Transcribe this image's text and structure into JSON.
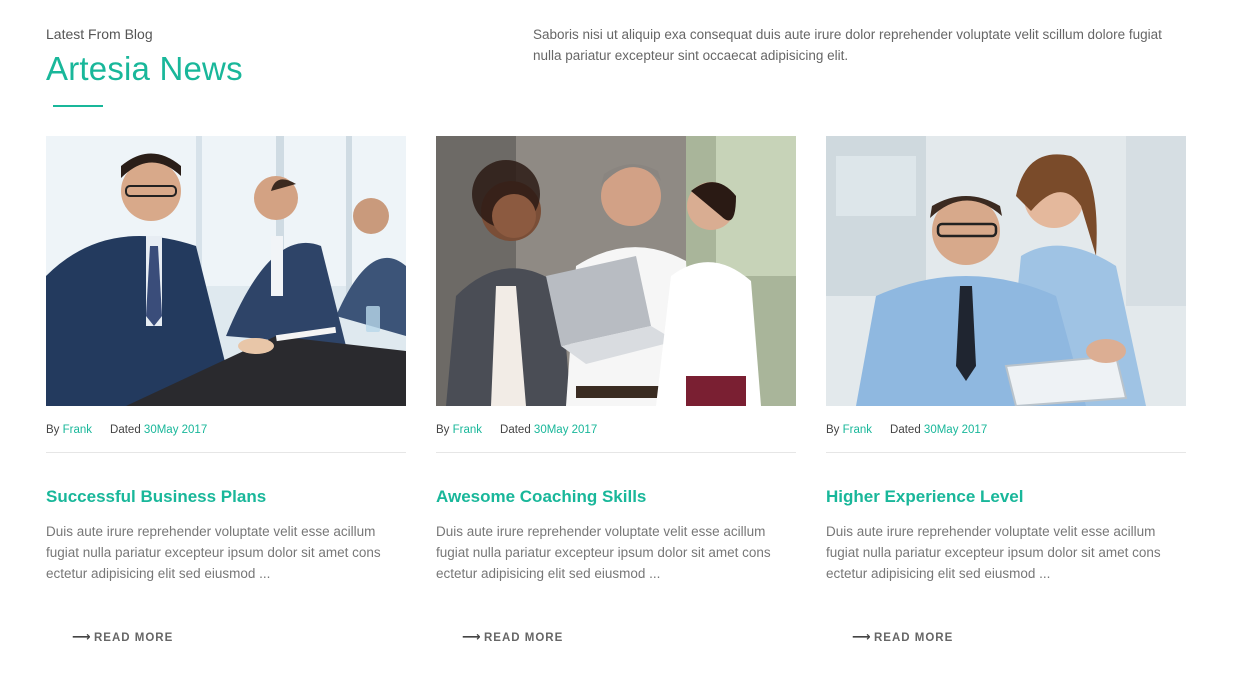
{
  "header": {
    "eyebrow": "Latest From Blog",
    "title": "Artesia News",
    "intro": "Saboris nisi ut aliquip exa consequat duis aute irure dolor reprehender voluptate velit scillum dolore fugiat nulla pariatur excepteur sint occaecat adipisicing elit."
  },
  "colors": {
    "accent": "#19b79a",
    "text": "#666666",
    "rule": "#e6e6e6"
  },
  "posts": [
    {
      "by_label": "By",
      "author": "Frank",
      "dated_label": "Dated",
      "date": "30May 2017",
      "title": "Successful Business Plans",
      "excerpt": "Duis aute irure reprehender voluptate velit esse acillum fugiat nulla pariatur excepteur ipsum dolor sit amet cons ectetur adipisicing elit sed eiusmod ...",
      "read_more": "READ MORE",
      "read_more_icon": "long-arrow-right-icon"
    },
    {
      "by_label": "By",
      "author": "Frank",
      "dated_label": "Dated",
      "date": "30May 2017",
      "title": "Awesome Coaching Skills",
      "excerpt": "Duis aute irure reprehender voluptate velit esse acillum fugiat nulla pariatur excepteur ipsum dolor sit amet cons ectetur adipisicing elit sed eiusmod ...",
      "read_more": "READ MORE",
      "read_more_icon": "long-arrow-right-icon"
    },
    {
      "by_label": "By",
      "author": "Frank",
      "dated_label": "Dated",
      "date": "30May 2017",
      "title": "Higher Experience Level",
      "excerpt": "Duis aute irure reprehender voluptate velit esse acillum fugiat nulla pariatur excepteur ipsum dolor sit amet cons ectetur adipisicing elit sed eiusmod ...",
      "read_more": "READ MORE",
      "read_more_icon": "long-arrow-right-icon"
    }
  ]
}
